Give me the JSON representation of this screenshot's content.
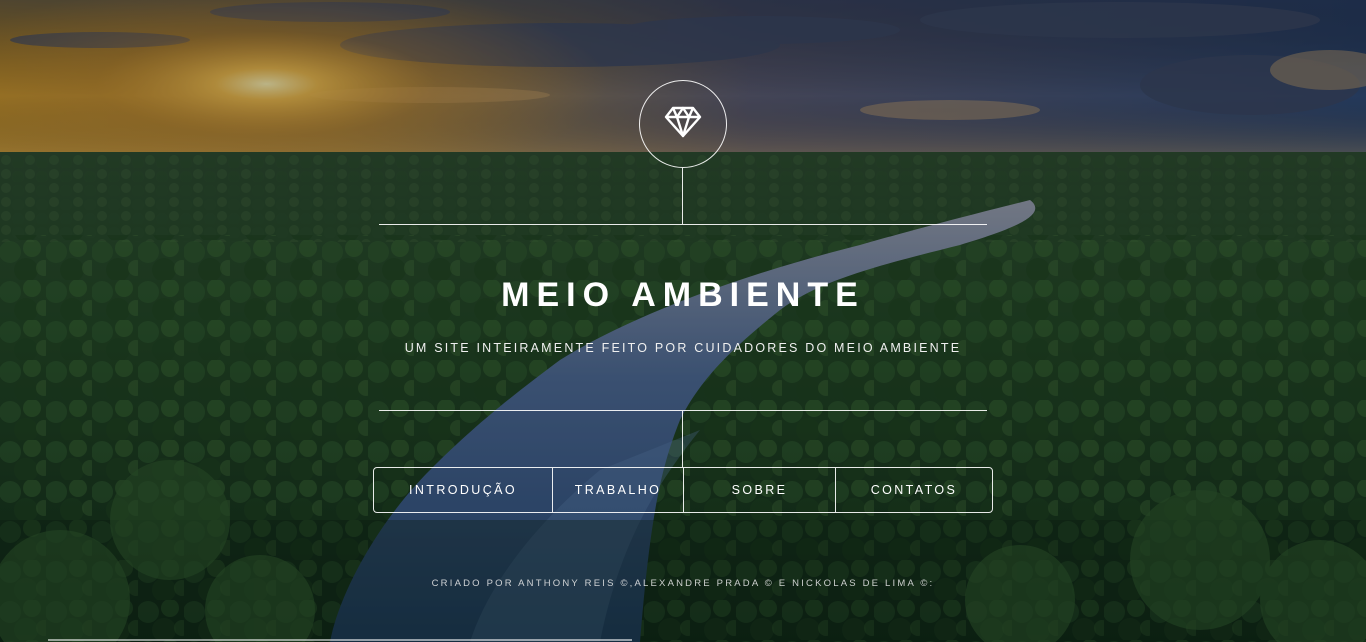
{
  "header": {
    "logo_icon": "diamond-icon",
    "title": "MEIO AMBIENTE",
    "subtitle": "UM SITE INTEIRAMENTE FEITO POR CUIDADORES DO MEIO AMBIENTE"
  },
  "nav": {
    "items": [
      {
        "label": "INTRODUÇÃO"
      },
      {
        "label": "TRABALHO"
      },
      {
        "label": "SOBRE"
      },
      {
        "label": "CONTATOS"
      }
    ]
  },
  "footer": {
    "credits": "CRIADO POR ANTHONY REIS ©,ALEXANDRE PRADA © E NICKOLAS DE LIMA ©:"
  },
  "colors": {
    "text": "#ffffff",
    "forest": "#1f4a22",
    "river": "#3d5f8a",
    "sun": "#f2b23a"
  }
}
